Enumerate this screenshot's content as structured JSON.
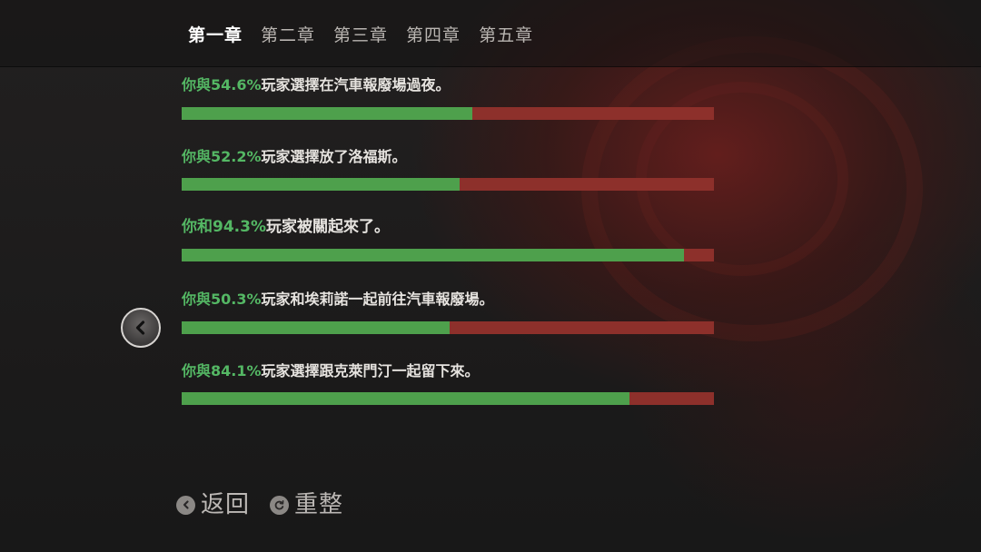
{
  "tabs": [
    {
      "label": "第一章",
      "active": true
    },
    {
      "label": "第二章",
      "active": false
    },
    {
      "label": "第三章",
      "active": false
    },
    {
      "label": "第四章",
      "active": false
    },
    {
      "label": "第五章",
      "active": false
    }
  ],
  "stats": [
    {
      "prefix": "你與",
      "percent": "54.6%",
      "suffix": "玩家選擇在汽車報廢場過夜。",
      "value": 54.6
    },
    {
      "prefix": "你與",
      "percent": "52.2%",
      "suffix": "玩家選擇放了洛福斯。",
      "value": 52.2
    },
    {
      "prefix": "你和",
      "percent": "94.3%",
      "suffix": "玩家被關起來了。",
      "value": 94.3
    },
    {
      "prefix": "你與",
      "percent": "50.3%",
      "suffix": "玩家和埃莉諾一起前往汽車報廢場。",
      "value": 50.3
    },
    {
      "prefix": "你與",
      "percent": "84.1%",
      "suffix": "玩家選擇跟克萊門汀一起留下來。",
      "value": 84.1
    }
  ],
  "colors": {
    "bar_agree": "#4ea04c",
    "bar_disagree": "#8d302b",
    "percent_text": "#54b764"
  },
  "nav": {
    "prev_icon": "chevron-left-icon"
  },
  "footer": {
    "back_label": "返回",
    "back_icon": "circle-arrow-left-icon",
    "reset_label": "重整",
    "reset_icon": "refresh-icon"
  }
}
